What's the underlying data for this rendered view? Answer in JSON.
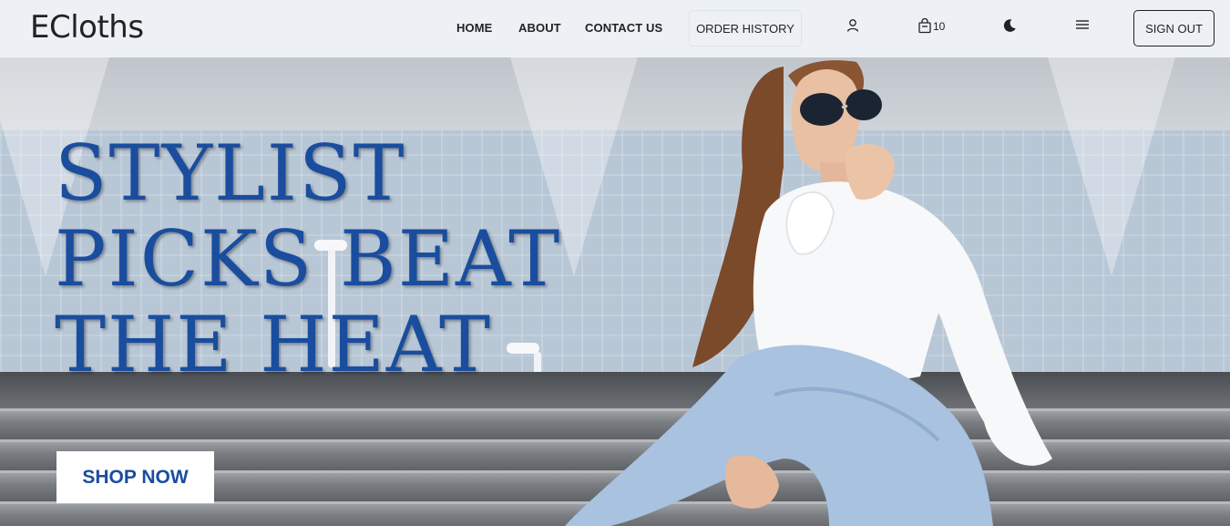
{
  "brand": "ECloths",
  "nav": {
    "home": "HOME",
    "about": "ABOUT",
    "contact": "CONTACT US",
    "order_history": "ORDER HISTORY",
    "cart_count": "10",
    "sign_out": "SIGN OUT"
  },
  "icons": {
    "user": "user-icon",
    "cart": "shopping-bag-icon",
    "theme": "moon-icon",
    "menu": "hamburger-menu-icon"
  },
  "hero": {
    "headline_line1": "STYLIST",
    "headline_line2": "PICKS BEAT",
    "headline_line3": "THE HEAT",
    "cta": "SHOP NOW"
  },
  "colors": {
    "navbar_bg": "#edf1f5",
    "headline": "#1a4d9e",
    "cta_text": "#1a4d9e"
  }
}
